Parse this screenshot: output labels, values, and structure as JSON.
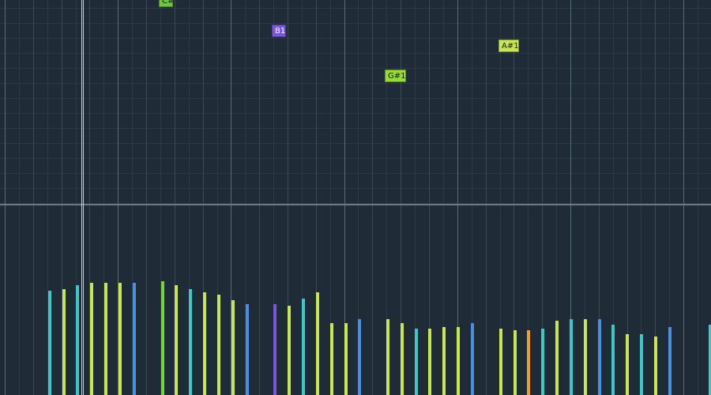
{
  "colors": {
    "background": "#1f2b37",
    "teal": "#3cc8c8",
    "yellow_green": "#c8e650",
    "green": "#78d23c",
    "blue": "#4a8ee0",
    "purple": "#7856e0",
    "orange": "#f0a020",
    "lime": "#96dc32"
  },
  "piano_roll": {
    "notes": [
      {
        "label": "C#",
        "color": "#6ec83c"
      },
      {
        "label": "B1",
        "color": "#7856e0"
      },
      {
        "label": "G#1",
        "color": "#96dc32"
      },
      {
        "label": "A#1",
        "color": "#c8e650"
      }
    ]
  },
  "velocity_lane": {
    "bars": [
      {
        "color": "#3cc8c8",
        "value": 0.55
      },
      {
        "color": "#c8e650",
        "value": 0.56
      },
      {
        "color": "#3cc8c8",
        "value": 0.58
      },
      {
        "color": "#c8e650",
        "value": 0.59
      },
      {
        "color": "#c8e650",
        "value": 0.59
      },
      {
        "color": "#c8e650",
        "value": 0.59
      },
      {
        "color": "#4a8ee0",
        "value": 0.59
      },
      {
        "color": "#78d23c",
        "value": 0.6
      },
      {
        "color": "#c8e650",
        "value": 0.58
      },
      {
        "color": "#3cc8c8",
        "value": 0.56
      },
      {
        "color": "#c8e650",
        "value": 0.54
      },
      {
        "color": "#c8e650",
        "value": 0.53
      },
      {
        "color": "#c8e650",
        "value": 0.5
      },
      {
        "color": "#4a8ee0",
        "value": 0.48
      },
      {
        "color": "#7856e0",
        "value": 0.48
      },
      {
        "color": "#c8e650",
        "value": 0.47
      },
      {
        "color": "#3cc8c8",
        "value": 0.51
      },
      {
        "color": "#c8e650",
        "value": 0.54
      },
      {
        "color": "#c8e650",
        "value": 0.38
      },
      {
        "color": "#c8e650",
        "value": 0.38
      },
      {
        "color": "#4a8ee0",
        "value": 0.4
      },
      {
        "color": "#c8e650",
        "value": 0.4
      },
      {
        "color": "#c8e650",
        "value": 0.38
      },
      {
        "color": "#3cc8c8",
        "value": 0.35
      },
      {
        "color": "#c8e650",
        "value": 0.35
      },
      {
        "color": "#c8e650",
        "value": 0.36
      },
      {
        "color": "#c8e650",
        "value": 0.36
      },
      {
        "color": "#4a8ee0",
        "value": 0.38
      },
      {
        "color": "#c8e650",
        "value": 0.35
      },
      {
        "color": "#c8e650",
        "value": 0.34
      },
      {
        "color": "#f0a020",
        "value": 0.34
      },
      {
        "color": "#3cc8c8",
        "value": 0.35
      },
      {
        "color": "#c8e650",
        "value": 0.39
      },
      {
        "color": "#3cc8c8",
        "value": 0.4
      },
      {
        "color": "#c8e650",
        "value": 0.4
      },
      {
        "color": "#4a8ee0",
        "value": 0.4
      },
      {
        "color": "#3cc8c8",
        "value": 0.37
      },
      {
        "color": "#c8e650",
        "value": 0.32
      },
      {
        "color": "#3cc8c8",
        "value": 0.32
      },
      {
        "color": "#c8e650",
        "value": 0.31
      },
      {
        "color": "#4a8ee0",
        "value": 0.36
      },
      {
        "color": "#3cc8c8",
        "value": 0.37
      }
    ]
  }
}
